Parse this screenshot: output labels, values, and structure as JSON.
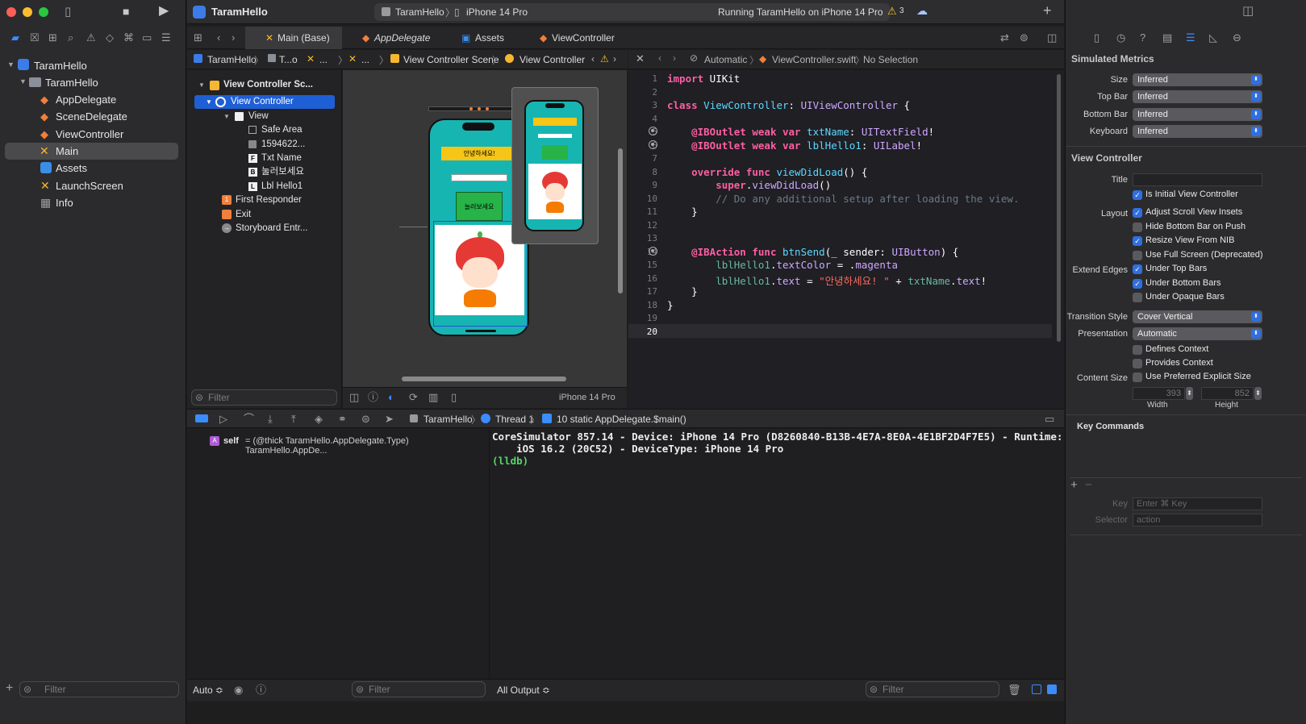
{
  "navigator": {
    "items": [
      {
        "label": "TaramHello",
        "kind": "project"
      },
      {
        "label": "TaramHello",
        "kind": "folder"
      },
      {
        "label": "AppDelegate",
        "kind": "swift"
      },
      {
        "label": "SceneDelegate",
        "kind": "swift"
      },
      {
        "label": "ViewController",
        "kind": "swift"
      },
      {
        "label": "Main",
        "kind": "storyboard"
      },
      {
        "label": "Assets",
        "kind": "assets"
      },
      {
        "label": "LaunchScreen",
        "kind": "storyboard"
      },
      {
        "label": "Info",
        "kind": "plist"
      }
    ],
    "filter_placeholder": "Filter"
  },
  "toolbar": {
    "project_name": "TaramHello",
    "scheme": "TaramHello",
    "destination": "iPhone 14 Pro",
    "status": "Running TaramHello on iPhone 14 Pro",
    "warning_count": "3"
  },
  "tabs": [
    {
      "label": "Main (Base)",
      "active": true
    },
    {
      "label": "AppDelegate",
      "active": false
    },
    {
      "label": "Assets",
      "active": false
    },
    {
      "label": "ViewController",
      "active": false
    }
  ],
  "jumpbar_left": {
    "c1": "TaramHello",
    "c2": "T...o",
    "c3": "...",
    "c4": "...",
    "c5": "View Controller Scene",
    "c6": "View Controller"
  },
  "jumpbar_right": {
    "c1": "Automatic",
    "c2": "ViewController.swift",
    "c3": "No Selection"
  },
  "outline": {
    "rows": [
      {
        "label": "View Controller Sc..."
      },
      {
        "label": "View Controller"
      },
      {
        "label": "View"
      },
      {
        "label": "Safe Area"
      },
      {
        "label": "1594622..."
      },
      {
        "label": "Txt Name"
      },
      {
        "label": "눌러보세요"
      },
      {
        "label": "Lbl Hello1"
      },
      {
        "label": "First Responder"
      },
      {
        "label": "Exit"
      },
      {
        "label": "Storyboard Entr..."
      }
    ],
    "filter_placeholder": "Filter"
  },
  "canvas": {
    "phone_label": "안녕하세요!",
    "phone_button": "눌러보세요",
    "device_label": "iPhone 14 Pro"
  },
  "code": {
    "lines": [
      "1",
      "2",
      "3",
      "4",
      "5",
      "6",
      "7",
      "8",
      "9",
      "10",
      "11",
      "12",
      "13",
      "14",
      "15",
      "16",
      "17",
      "18",
      "19",
      "20"
    ],
    "l1a": "import",
    "l1b": " UIKit",
    "l3a": "class",
    "l3b": " ViewController",
    "l3c": ": ",
    "l3d": "UIViewController",
    "l3e": " {",
    "l5a": "    @IBOutlet",
    "l5b": " weak var",
    "l5c": " txtName",
    "l5d": ": ",
    "l5e": "UITextField",
    "l5f": "!",
    "l6a": "    @IBOutlet",
    "l6b": " weak var",
    "l6c": " lblHello1",
    "l6d": ": ",
    "l6e": "UILabel",
    "l6f": "!",
    "l8a": "    override func",
    "l8b": " viewDidLoad",
    "l8c": "() {",
    "l9a": "        super",
    "l9b": ".",
    "l9c": "viewDidLoad",
    "l9d": "()",
    "l10": "        // Do any additional setup after loading the view.",
    "l11": "    }",
    "l14a": "    @IBAction",
    "l14b": " func",
    "l14c": " btnSend",
    "l14d": "(_ sender: ",
    "l14e": "UIButton",
    "l14f": ") {",
    "l15a": "        lblHello1",
    "l15b": ".",
    "l15c": "textColor",
    "l15d": " = .",
    "l15e": "magenta",
    "l16a": "        lblHello1",
    "l16b": ".",
    "l16c": "text",
    "l16d": " = ",
    "l16e": "\"안녕하세요! \"",
    "l16f": " + ",
    "l16g": "txtName",
    "l16h": ".",
    "l16i": "text",
    "l16j": "!",
    "l17": "    }",
    "l18": "}"
  },
  "debug": {
    "scheme": "TaramHello",
    "thread": "Thread 1",
    "frame": "10 static AppDelegate.$main()",
    "var_name": "self",
    "var_value": "= (@thick TaramHello.AppDelegate.Type) TaramHello.AppDe...",
    "console_line1": "CoreSimulator 857.14 - Device: iPhone 14 Pro (D8260840-B13B-4E7A-8E0A-4E1BF2D4F7E5) - Runtime:",
    "console_line2": "    iOS 16.2 (20C52) - DeviceType: iPhone 14 Pro",
    "console_prompt": "(lldb)",
    "auto_label": "Auto ≎",
    "output_label": "All Output ≎",
    "filter_placeholder": "Filter"
  },
  "inspector": {
    "simulated_metrics": "Simulated Metrics",
    "size_label": "Size",
    "size_value": "Inferred",
    "topbar_label": "Top Bar",
    "topbar_value": "Inferred",
    "bottombar_label": "Bottom Bar",
    "bottombar_value": "Inferred",
    "keyboard_label": "Keyboard",
    "keyboard_value": "Inferred",
    "view_controller": "View Controller",
    "title_label": "Title",
    "is_initial": "Is Initial View Controller",
    "layout_label": "Layout",
    "adjust_scroll": "Adjust Scroll View Insets",
    "hide_bottom": "Hide Bottom Bar on Push",
    "resize_view": "Resize View From NIB",
    "full_screen": "Use Full Screen (Deprecated)",
    "extend_label": "Extend Edges",
    "under_top": "Under Top Bars",
    "under_bottom": "Under Bottom Bars",
    "under_opaque": "Under Opaque Bars",
    "transition_label": "Transition Style",
    "transition_value": "Cover Vertical",
    "presentation_label": "Presentation",
    "presentation_value": "Automatic",
    "defines_context": "Defines Context",
    "provides_context": "Provides Context",
    "content_size_label": "Content Size",
    "preferred_explicit": "Use Preferred Explicit Size",
    "width_value": "393",
    "height_value": "852",
    "width_label": "Width",
    "height_label": "Height",
    "key_commands": "Key Commands",
    "key_label": "Key",
    "key_placeholder": "Enter ⌘ Key",
    "selector_label": "Selector",
    "selector_value": "action"
  }
}
